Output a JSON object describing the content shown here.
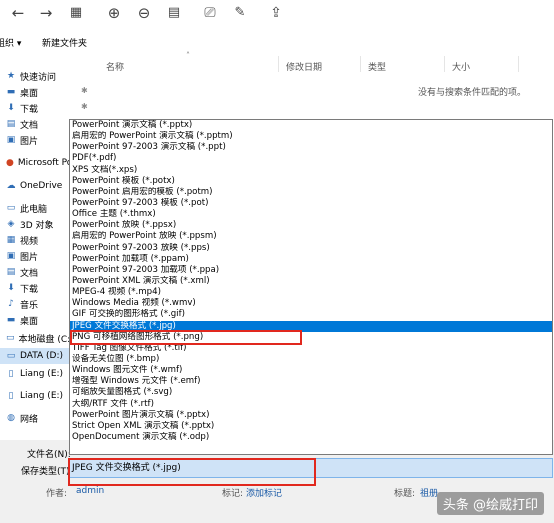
{
  "toolbar": {
    "icons": [
      "back-arrow",
      "forward-arrow",
      "grid-view",
      "zoom-in",
      "zoom-out",
      "fit-page",
      "rotate",
      "edit",
      "upload"
    ]
  },
  "commandbar": {
    "organize": "组织 ▾",
    "new_folder": "新建文件夹"
  },
  "columns": {
    "name": "名称",
    "modified": "修改日期",
    "type": "类型",
    "size": "大小"
  },
  "empty_message": "没有与搜索条件匹配的项。",
  "nav": [
    {
      "label": "快速访问",
      "icon": "★"
    },
    {
      "label": "桌面",
      "icon": "▬"
    },
    {
      "label": "下载",
      "icon": "⬇"
    },
    {
      "label": "文档",
      "icon": "▤"
    },
    {
      "label": "图片",
      "icon": "▣"
    },
    {
      "label": "Microsoft Pov",
      "icon": "●"
    },
    {
      "label": "OneDrive",
      "icon": "☁"
    },
    {
      "label": "此电脑",
      "icon": "▭"
    },
    {
      "label": "3D 对象",
      "icon": "◈"
    },
    {
      "label": "视频",
      "icon": "▦"
    },
    {
      "label": "图片",
      "icon": "▣"
    },
    {
      "label": "文档",
      "icon": "▤"
    },
    {
      "label": "下载",
      "icon": "⬇"
    },
    {
      "label": "音乐",
      "icon": "♪"
    },
    {
      "label": "桌面",
      "icon": "▬"
    },
    {
      "label": "本地磁盘 (C:)",
      "icon": "▭"
    },
    {
      "label": "DATA (D:)",
      "icon": "▭"
    },
    {
      "label": "Liang (E:)",
      "icon": "▯"
    },
    {
      "label": "Liang (E:)",
      "icon": "▯"
    },
    {
      "label": "网络",
      "icon": "◍"
    }
  ],
  "dropdown_items": [
    "PowerPoint 演示文稿 (*.pptx)",
    "启用宏的 PowerPoint 演示文稿 (*.pptm)",
    "PowerPoint 97-2003 演示文稿 (*.ppt)",
    "PDF(*.pdf)",
    "XPS 文档(*.xps)",
    "PowerPoint 模板 (*.potx)",
    "PowerPoint 启用宏的模板 (*.potm)",
    "PowerPoint 97-2003 模板 (*.pot)",
    "Office 主题 (*.thmx)",
    "PowerPoint 放映 (*.ppsx)",
    "启用宏的 PowerPoint 放映 (*.ppsm)",
    "PowerPoint 97-2003 放映 (*.pps)",
    "PowerPoint 加载项 (*.ppam)",
    "PowerPoint 97-2003 加载项 (*.ppa)",
    "PowerPoint XML 演示文稿 (*.xml)",
    "MPEG-4 视频 (*.mp4)",
    "Windows Media 视频 (*.wmv)",
    "GIF 可交换的图形格式 (*.gif)",
    "JPEG 文件交换格式 (*.jpg)",
    "PNG 可移植网络图形格式 (*.png)",
    "TIFF Tag 图像文件格式 (*.tif)",
    "设备无关位图 (*.bmp)",
    "Windows 图元文件 (*.wmf)",
    "增强型 Windows 元文件 (*.emf)",
    "可缩放矢量图格式 (*.svg)",
    "大纲/RTF 文件 (*.rtf)",
    "PowerPoint 图片演示文稿 (*.pptx)",
    "Strict Open XML 演示文稿 (*.pptx)",
    "OpenDocument 演示文稿 (*.odp)"
  ],
  "selected_index": 18,
  "form": {
    "filename_label": "文件名(N):",
    "savetype_label": "保存类型(T):",
    "savetype_value": "JPEG 文件交换格式 (*.jpg)"
  },
  "meta": {
    "author_label": "作者:",
    "author_value": "admin",
    "tags_label": "标记:",
    "tags_value": "添加标记",
    "title_label": "标题:",
    "title_value": "祖册"
  },
  "watermark": "头条 @绘威打印",
  "colors": {
    "highlight": "#0078d7",
    "selection_bg": "#cfe3f7",
    "red_box": "#e1281e"
  }
}
